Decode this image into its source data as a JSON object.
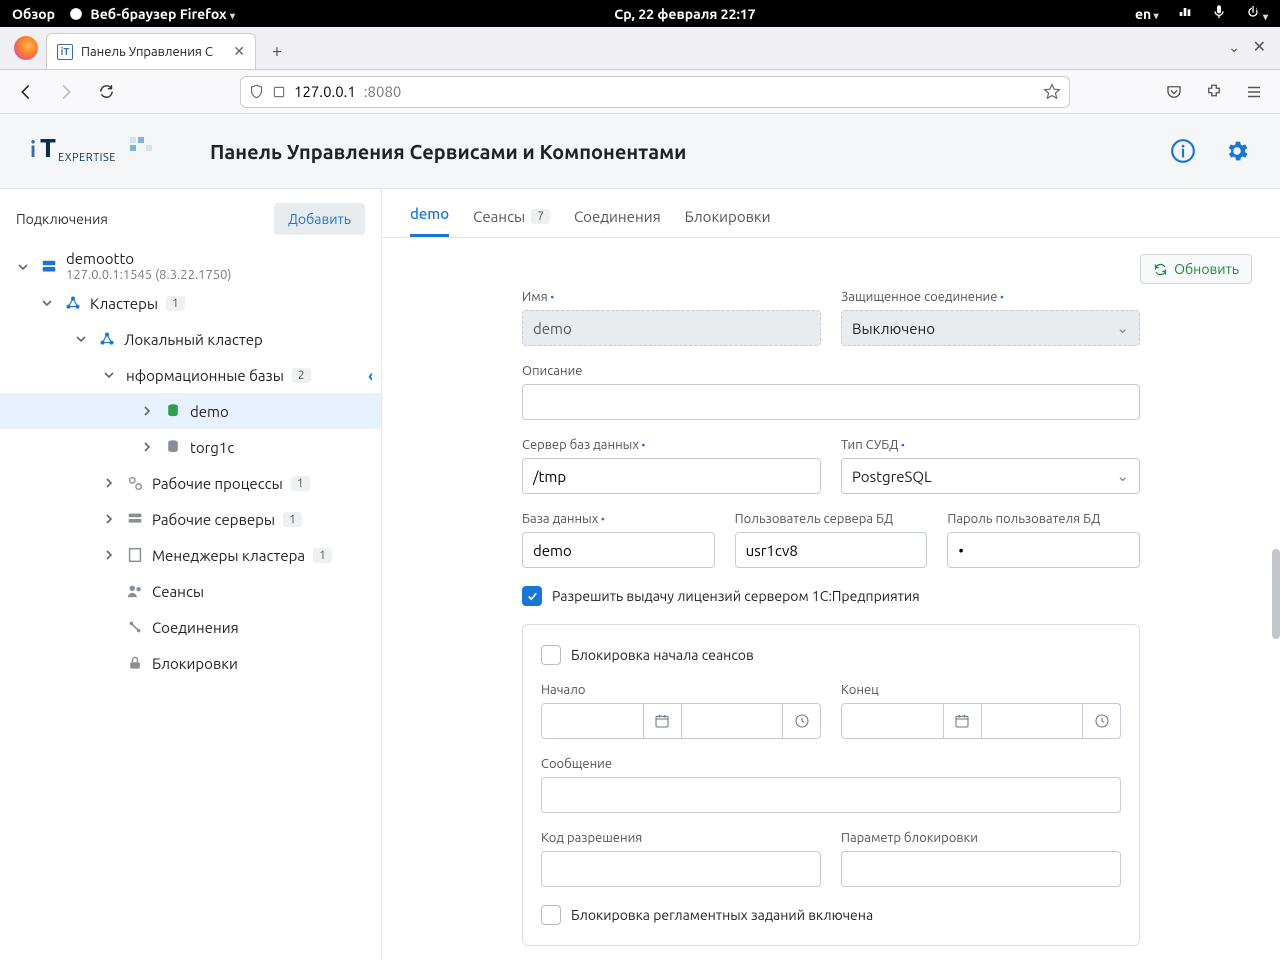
{
  "os": {
    "activities": "Обзор",
    "app_menu": "Веб-браузер Firefox",
    "clock": "Ср, 22 февраля  22:17",
    "lang": "en"
  },
  "browser": {
    "tab_title": "Панель Управления С",
    "url_host": "127.0.0.1",
    "url_port": ":8080"
  },
  "header": {
    "title": "Панель Управления Сервисами и Компонентами"
  },
  "sidebar": {
    "title": "Подключения",
    "add": "Добавить",
    "conn_name": "demootto",
    "conn_addr": "127.0.0.1:1545 (8.3.22.1750)",
    "clusters": "Кластеры",
    "clusters_n": "1",
    "local_cluster": "Локальный кластер",
    "infobases": "нформационные базы",
    "infobases_n": "2",
    "ib1": "demo",
    "ib2": "torg1c",
    "wprocs": "Рабочие процессы",
    "wprocs_n": "1",
    "wservers": "Рабочие серверы",
    "wservers_n": "1",
    "managers": "Менеджеры кластера",
    "managers_n": "1",
    "sessions": "Сеансы",
    "connections": "Соединения",
    "locks": "Блокировки"
  },
  "tabs": {
    "t1": "demo",
    "t2": "Сеансы",
    "t2n": "7",
    "t3": "Соединения",
    "t4": "Блокировки"
  },
  "refresh": "Обновить",
  "form": {
    "name_l": "Имя",
    "name_v": "demo",
    "sec_l": "Защищенное соединение",
    "sec_v": "Выключено",
    "desc_l": "Описание",
    "desc_v": "",
    "dbserv_l": "Сервер баз данных",
    "dbserv_v": "/tmp",
    "dbtype_l": "Тип СУБД",
    "dbtype_v": "PostgreSQL",
    "dbname_l": "База данных",
    "dbname_v": "demo",
    "dbuser_l": "Пользователь сервера БД",
    "dbuser_v": "usr1cv8",
    "dbpass_l": "Пароль пользователя БД",
    "dbpass_v": "•",
    "lic_l": "Разрешить выдачу лицензий сервером 1С:Предприятия",
    "block_sess_l": "Блокировка начала сеансов",
    "start_l": "Начало",
    "end_l": "Конец",
    "msg_l": "Сообщение",
    "permcode_l": "Код разрешения",
    "blockparam_l": "Параметр блокировки",
    "block_jobs_l": "Блокировка регламентных заданий включена"
  }
}
